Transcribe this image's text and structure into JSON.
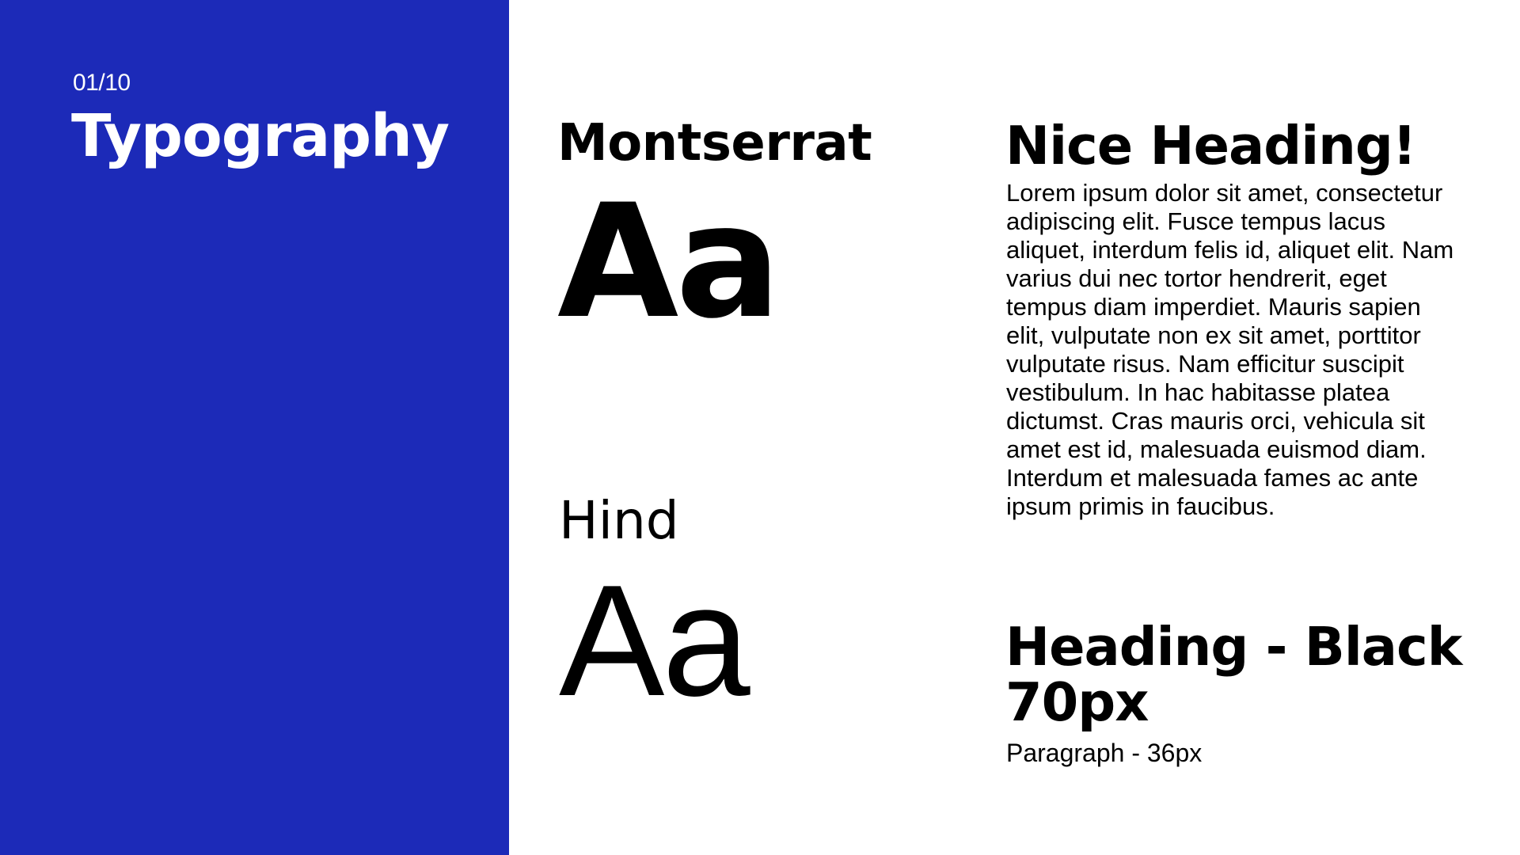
{
  "colors": {
    "panel_background": "#1c2ab8",
    "panel_text": "#ffffff",
    "page_background": "#ffffff",
    "body_text": "#000000"
  },
  "side_panel": {
    "page_counter": "01/10",
    "title": "Typography"
  },
  "fonts": [
    {
      "name": "Montserrat",
      "specimen": "Aa"
    },
    {
      "name": "Hind",
      "specimen": "Aa"
    }
  ],
  "example": {
    "heading": "Nice Heading!",
    "paragraph": "Lorem ipsum dolor sit amet, consectetur adipiscing elit. Fusce tempus lacus aliquet, interdum felis id, aliquet elit. Nam varius dui nec tortor hendrerit, eget tempus diam imperdiet. Mauris sapien elit, vulputate non ex sit amet, porttitor vulputate risus. Nam efficitur suscipit vestibulum. In hac habitasse platea dictumst. Cras mauris orci, vehicula sit amet est id, malesuada euismod diam. Interdum et malesuada fames ac ante ipsum primis in faucibus."
  },
  "specs": {
    "heading": "Heading - Black 70px",
    "paragraph": "Paragraph - 36px"
  }
}
